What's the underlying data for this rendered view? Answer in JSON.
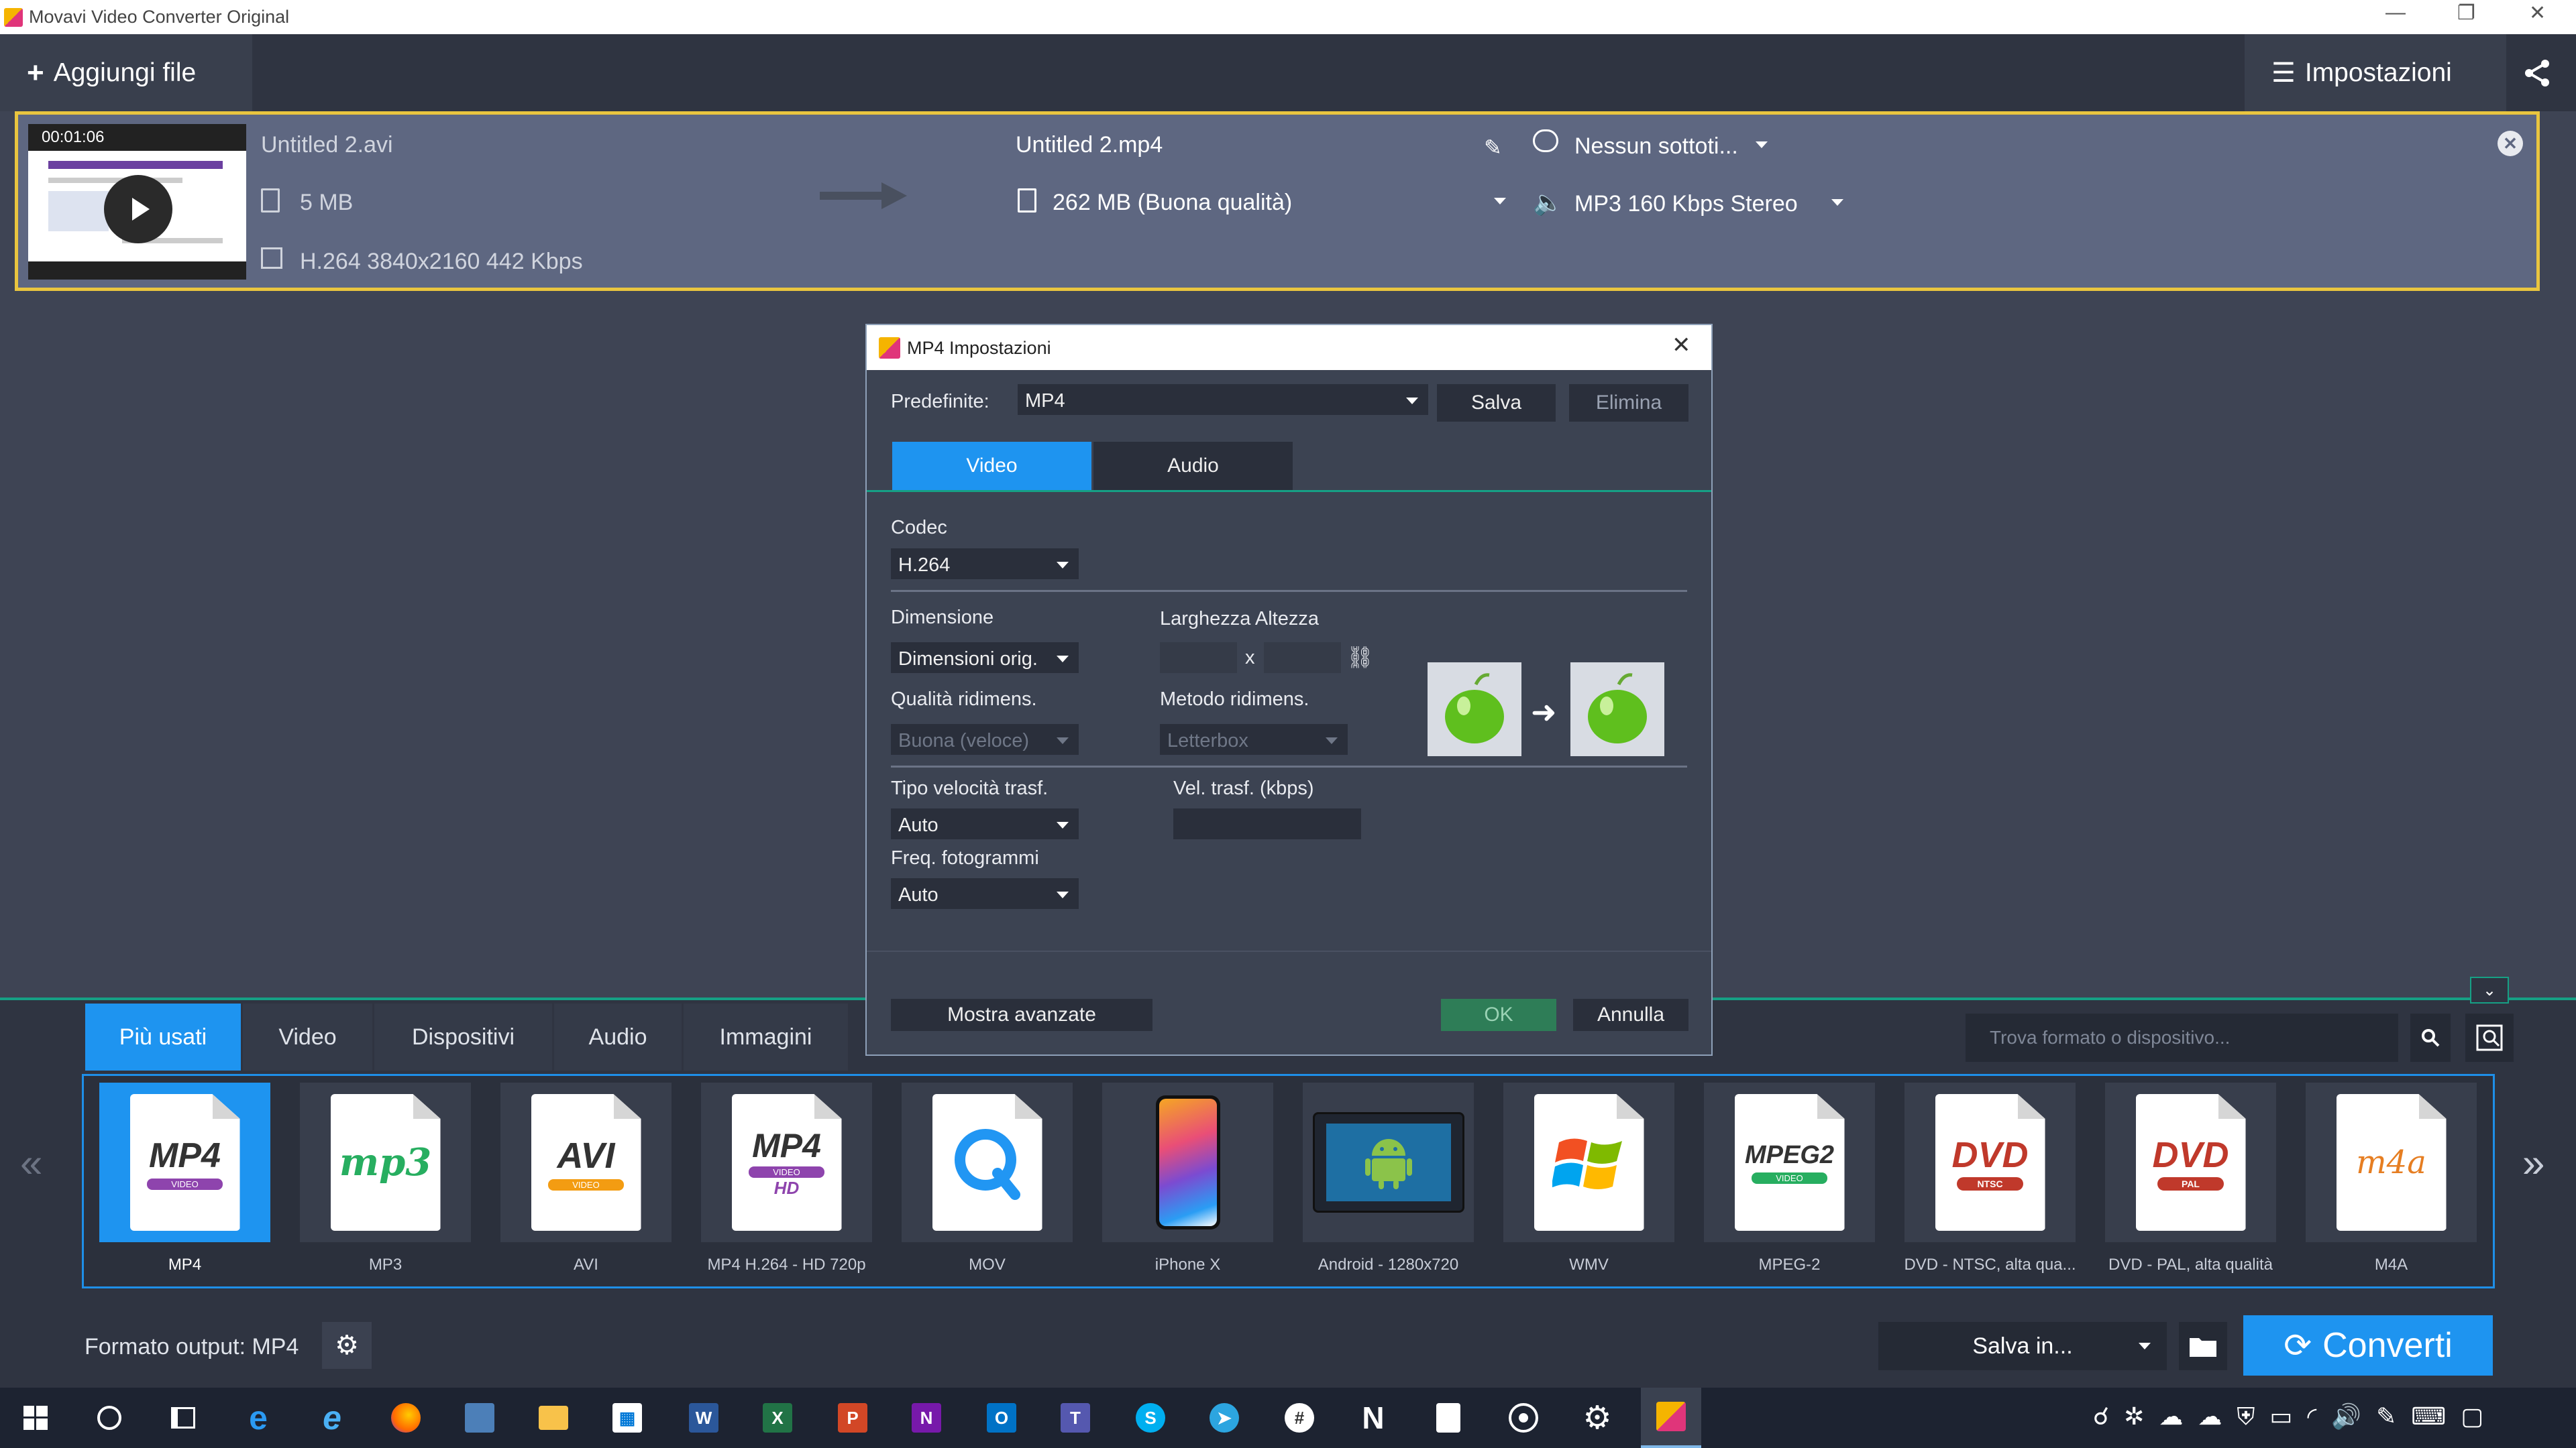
{
  "window": {
    "title": "Movavi Video Converter Original",
    "minimize": "—",
    "restore": "❐",
    "close": "✕"
  },
  "toolbar": {
    "add_file": "Aggiungi file",
    "settings": "Impostazioni"
  },
  "file": {
    "timecode": "00:01:06",
    "source_name": "Untitled 2.avi",
    "source_size": "5 MB",
    "source_info": "H.264 3840x2160 442 Kbps",
    "output_name": "Untitled 2.mp4",
    "output_size": "262 MB (Buona qualità)",
    "subtitles": "Nessun sottoti...",
    "audio": "MP3 160 Kbps Stereo"
  },
  "dialog": {
    "title": "MP4 Impostazioni",
    "preset_label": "Predefinite:",
    "preset_value": "MP4",
    "save": "Salva",
    "delete": "Elimina",
    "tab_video": "Video",
    "tab_audio": "Audio",
    "codec_label": "Codec",
    "codec_value": "H.264",
    "dimension_label": "Dimensione",
    "dimension_value": "Dimensioni orig.",
    "width_height_label": "Larghezza Altezza",
    "x_sep": "x",
    "resize_quality_label": "Qualità ridimens.",
    "resize_quality_value": "Buona (veloce)",
    "resize_method_label": "Metodo ridimens.",
    "resize_method_value": "Letterbox",
    "bitrate_type_label": "Tipo velocità trasf.",
    "bitrate_type_value": "Auto",
    "bitrate_label": "Vel. trasf. (kbps)",
    "framerate_label": "Freq. fotogrammi",
    "framerate_value": "Auto",
    "advanced": "Mostra avanzate",
    "ok": "OK",
    "cancel": "Annulla"
  },
  "format_tabs": [
    "Più usati",
    "Video",
    "Dispositivi",
    "Audio",
    "Immagini"
  ],
  "search": {
    "placeholder": "Trova formato o dispositivo..."
  },
  "formats": [
    {
      "label": "MP4",
      "icon": "mp4-icon",
      "main": "MP4",
      "sub": "VIDEO"
    },
    {
      "label": "MP3",
      "icon": "mp3-icon",
      "main": "mp3",
      "sub": ""
    },
    {
      "label": "AVI",
      "icon": "avi-icon",
      "main": "AVI",
      "sub": "VIDEO"
    },
    {
      "label": "MP4 H.264 - HD 720p",
      "icon": "mp4-hd-icon",
      "main": "MP4",
      "sub": "VIDEO",
      "extra": "HD"
    },
    {
      "label": "MOV",
      "icon": "quicktime-icon",
      "main": "",
      "sub": ""
    },
    {
      "label": "iPhone X",
      "icon": "iphone-icon",
      "main": "",
      "sub": ""
    },
    {
      "label": "Android - 1280x720",
      "icon": "android-icon",
      "main": "",
      "sub": ""
    },
    {
      "label": "WMV",
      "icon": "windows-media-icon",
      "main": "",
      "sub": ""
    },
    {
      "label": "MPEG-2",
      "icon": "mpeg2-icon",
      "main": "MPEG2",
      "sub": "VIDEO"
    },
    {
      "label": "DVD - NTSC, alta qua...",
      "icon": "dvd-ntsc-icon",
      "main": "DVD",
      "sub": "NTSC"
    },
    {
      "label": "DVD - PAL, alta qualità",
      "icon": "dvd-pal-icon",
      "main": "DVD",
      "sub": "PAL"
    },
    {
      "label": "M4A",
      "icon": "m4a-icon",
      "main": "m4a",
      "sub": ""
    }
  ],
  "footer": {
    "output_format": "Formato output: MP4",
    "save_in": "Salva in...",
    "convert": "Converti"
  },
  "colors": {
    "accent": "#1e94f0",
    "highlight_border": "#e9c53f",
    "ok_button": "#2e7d57"
  }
}
